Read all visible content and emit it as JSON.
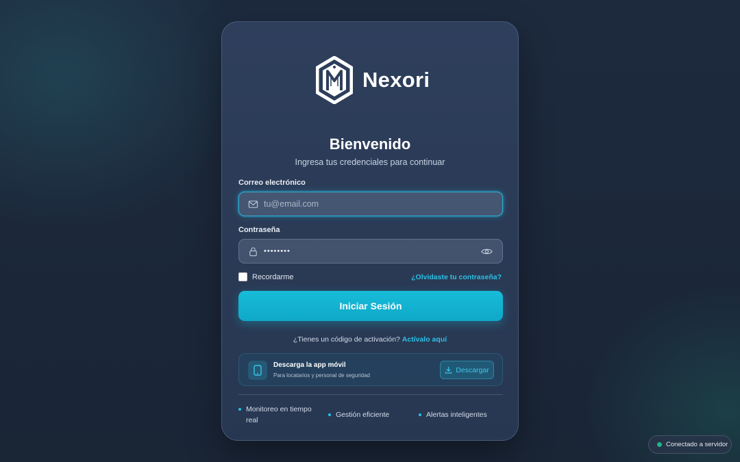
{
  "brand": {
    "name": "Nexori"
  },
  "header": {
    "title": "Bienvenido",
    "subtitle": "Ingresa tus credenciales para continuar"
  },
  "form": {
    "email_label": "Correo electrónico",
    "email_placeholder": "tu@email.com",
    "email_value": "",
    "password_label": "Contraseña",
    "password_value": "••••••••",
    "remember_label": "Recordarme",
    "remember_checked": false,
    "forgot_link": "¿Olvidaste tu contraseña?",
    "submit_label": "Iniciar Sesión"
  },
  "activation": {
    "question": "¿Tienes un código de activación?",
    "link": "Actívalo aquí"
  },
  "app_promo": {
    "title": "Descarga la app móvil",
    "subtitle": "Para locatarios y personal de seguridad",
    "button": "Descargar"
  },
  "features": [
    "Monitoreo en tiempo real",
    "Gestión eficiente",
    "Alertas inteligentes"
  ],
  "status": {
    "text": "Conectado a servidor",
    "color": "#1fb48a"
  },
  "colors": {
    "accent": "#17bcd8",
    "card": "#2e3f5c",
    "background": "#1d2a3e"
  }
}
